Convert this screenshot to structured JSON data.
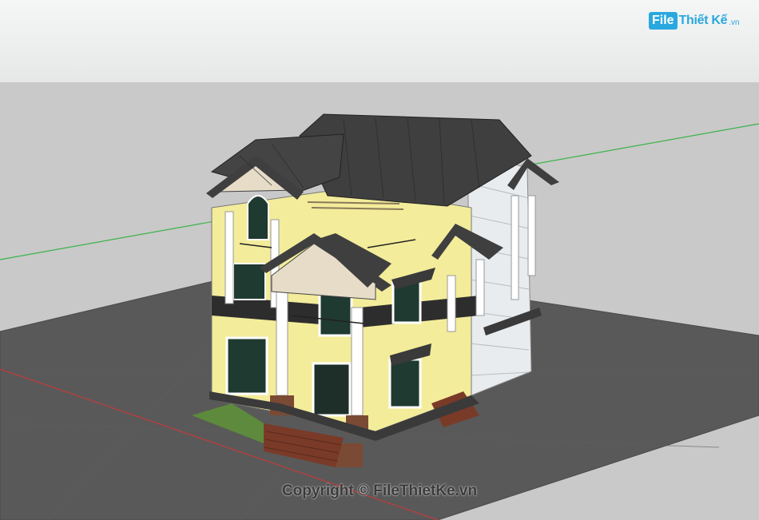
{
  "logo": {
    "badge": "File",
    "name": "Thiết Kế",
    "tld": ".vn",
    "icon": "brand-logo-icon"
  },
  "viewport": {
    "kind": "3d-model-viewport",
    "axis_colors": {
      "green": "#3bb34a",
      "red": "#c23b3b"
    }
  },
  "watermark": {
    "text": "Copyright © FileThietKe.vn"
  },
  "colors": {
    "sky": "#eef0f0",
    "ground": "#c9c9c9",
    "base_plane": "#555555",
    "wall": "#f3ec9a",
    "roof": "#3f3f3f",
    "column": "#ffffff",
    "window": "#1f3a30",
    "stairs": "#7a3a28"
  }
}
